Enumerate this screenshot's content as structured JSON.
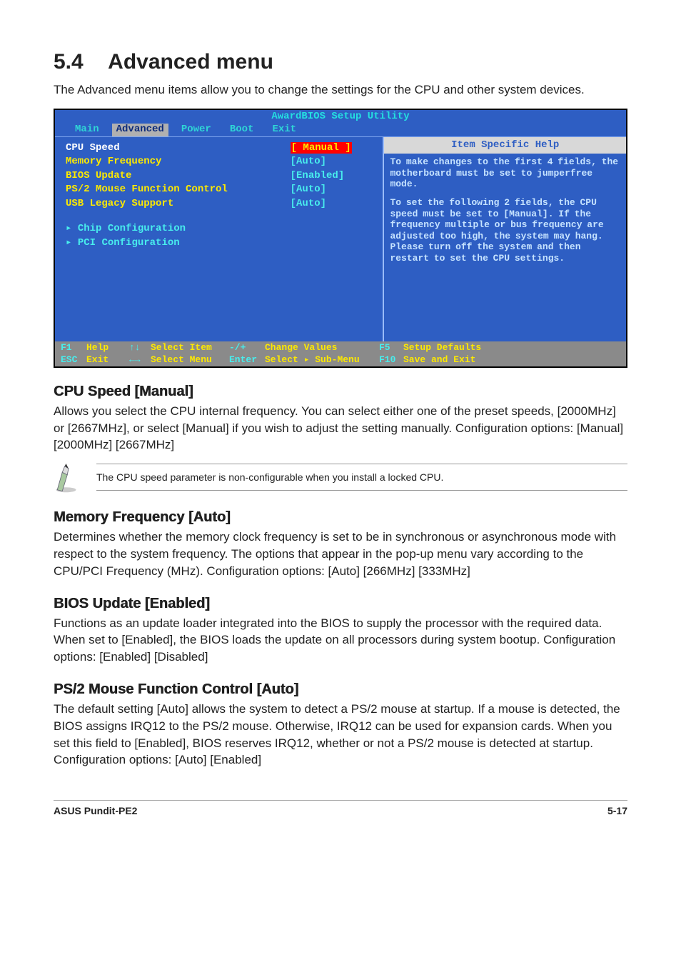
{
  "heading": {
    "number": "5.4",
    "title": "Advanced menu"
  },
  "intro": "The Advanced menu items allow you to change the settings for the CPU and other system devices.",
  "bios": {
    "title": "AwardBIOS Setup Utility",
    "tabs": {
      "t0": "Main",
      "t1": "Advanced",
      "t2": "Power",
      "t3": "Boot",
      "t4": "Exit"
    },
    "rows": {
      "r0": {
        "label": "CPU Speed",
        "value": "[ Manual ]"
      },
      "r1": {
        "label": "Memory Frequency",
        "value": "[Auto]"
      },
      "r2": {
        "label": "BIOS Update",
        "value": "[Enabled]"
      },
      "r3": {
        "label": "PS/2 Mouse Function Control",
        "value": "[Auto]"
      },
      "r4": {
        "label": "USB Legacy Support",
        "value": "[Auto]"
      },
      "r5": {
        "label": "Chip Configuration"
      },
      "r6": {
        "label": "PCI Configuration"
      }
    },
    "help": {
      "title": "Item Specific Help",
      "p1": "To make changes to the first 4 fields, the motherboard must be set to jumperfree mode.",
      "p2": "To set the following 2 fields, the CPU speed must be set to [Manual]. If the frequency multiple or bus frequency are adjusted too high, the system may hang. Please turn off the system and then restart to set the CPU settings."
    },
    "footer": {
      "f1k": "F1",
      "f1d": "Help",
      "f2k": "↑↓",
      "f2d": "Select Item",
      "f3k": "-/+",
      "f3d": "Change Values",
      "f4k": "F5",
      "f4d": "Setup Defaults",
      "f5k": "ESC",
      "f5d": "Exit",
      "f6k": "←→",
      "f6d": "Select Menu",
      "f7k": "Enter",
      "f7d": "Select ▸ Sub-Menu",
      "f8k": "F10",
      "f8d": "Save and Exit"
    }
  },
  "sec1": {
    "heading": "CPU Speed [Manual]",
    "body": "Allows you select the CPU internal frequency. You can select either one of the preset speeds, [2000MHz] or [2667MHz], or select [Manual] if you wish to adjust the setting manually. Configuration options: [Manual] [2000MHz] [2667MHz]"
  },
  "note": "The CPU speed parameter is non-configurable when you install a locked CPU.",
  "sec2": {
    "heading": "Memory Frequency [Auto]",
    "body": "Determines whether the memory clock frequency is set to be in synchronous or asynchronous mode with respect to the system frequency. The options that appear in the pop-up menu vary according to the CPU/PCI Frequency (MHz). Configuration options: [Auto] [266MHz] [333MHz]"
  },
  "sec3": {
    "heading": "BIOS Update [Enabled]",
    "body": "Functions as an update loader integrated into the BIOS to supply the processor with the required data. When set to [Enabled], the BIOS loads the update on all processors during system bootup. Configuration options: [Enabled] [Disabled]"
  },
  "sec4": {
    "heading": "PS/2 Mouse Function Control [Auto]",
    "body": "The default setting [Auto] allows the system to detect a PS/2 mouse at startup. If a mouse is detected, the BIOS assigns IRQ12 to the PS/2 mouse. Otherwise, IRQ12 can be used for expansion cards. When you set this field to [Enabled], BIOS reserves IRQ12, whether or not a PS/2 mouse is detected at startup. Configuration options: [Auto] [Enabled]"
  },
  "footer": {
    "left": "ASUS Pundit-PE2",
    "right": "5-17"
  }
}
